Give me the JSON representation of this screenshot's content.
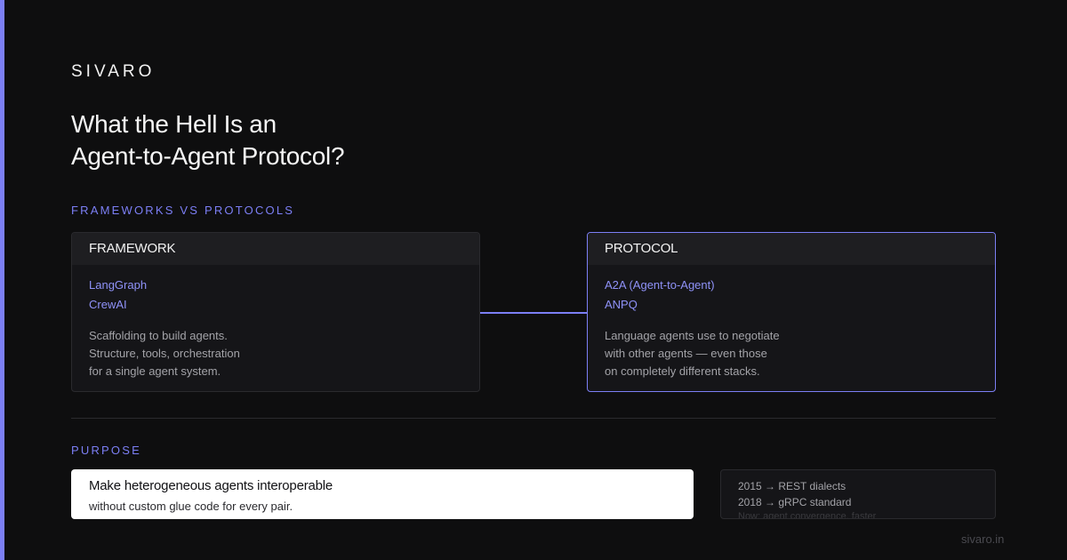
{
  "brand": "SIVARO",
  "title": {
    "line1": "What the Hell Is an",
    "line2": "Agent-to-Agent Protocol?"
  },
  "section_frameworks": "FRAMEWORKS VS PROTOCOLS",
  "framework_card": {
    "heading": "FRAMEWORK",
    "items": [
      "LangGraph",
      "CrewAI"
    ],
    "description": [
      "Scaffolding to build agents.",
      "Structure, tools, orchestration",
      "for a single agent system."
    ]
  },
  "protocol_card": {
    "heading": "PROTOCOL",
    "items": [
      "A2A (Agent-to-Agent)",
      "ANPQ"
    ],
    "description": [
      "Language agents use to negotiate",
      "with other agents — even those",
      "on completely different stacks."
    ]
  },
  "section_purpose": "PURPOSE",
  "purpose": {
    "heading": "Make heterogeneous agents interoperable",
    "subtext": "without custom glue code for every pair."
  },
  "timeline": [
    "2015 → REST dialects",
    "2018 → gRPC standard",
    "Now: agent convergence, faster"
  ],
  "footer_url": "sivaro.in",
  "colors": {
    "accent": "#7c7ff5",
    "background": "#0e0e0f",
    "card_background": "#151518",
    "purpose_background": "#ffffff"
  }
}
